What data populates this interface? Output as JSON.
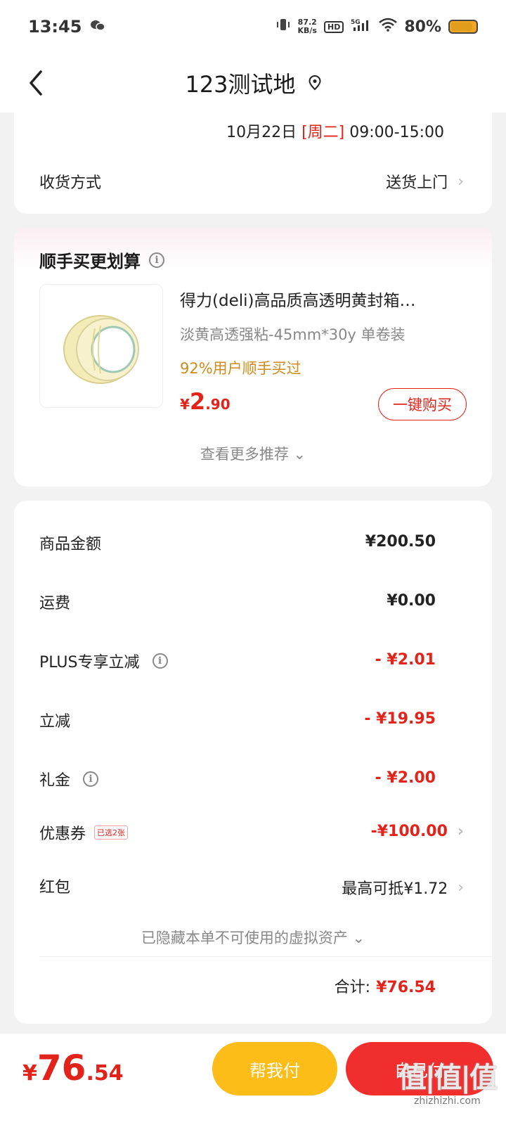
{
  "status_bar": {
    "time": "13:45",
    "net_speed_value": "87.2",
    "net_speed_unit": "KB/s",
    "hd": "HD",
    "network": "5G",
    "battery": "80%"
  },
  "header": {
    "title": "123测试地"
  },
  "delivery": {
    "date": "10月22日",
    "weekday": "[周二]",
    "time_range": "09:00-15:00",
    "method_label": "收货方式",
    "method_value": "送货上门"
  },
  "recommend": {
    "title": "顺手买更划算",
    "product": {
      "name": "得力(deli)高品质高透明黄封箱…",
      "spec": "淡黄高透强粘-45mm*30y 单卷装",
      "hint": "92%用户顺手买过",
      "price_symbol": "¥",
      "price_int": "2",
      "price_dec": ".90",
      "buy_label": "一键购买"
    },
    "more_label": "查看更多推荐 ⌄"
  },
  "fees": {
    "goods_label": "商品金额",
    "goods_value": "¥200.50",
    "shipping_label": "运费",
    "shipping_value": "¥0.00",
    "plus_label": "PLUS专享立减",
    "plus_value": "- ¥2.01",
    "discount_label": "立减",
    "discount_value": "- ¥19.95",
    "gift_label": "礼金",
    "gift_value": "- ¥2.00",
    "coupon_label": "优惠券",
    "coupon_tag": "已选2张",
    "coupon_value": "-¥100.00",
    "redpacket_label": "红包",
    "redpacket_value": "最高可抵¥1.72",
    "hidden_assets": "已隐藏本单不可使用的虚拟资产 ⌄",
    "total_label": "合计:",
    "total_value": "¥76.54"
  },
  "bottom": {
    "price_symbol": "¥",
    "price_int": "76",
    "price_dec": ".54",
    "help_pay": "帮我付",
    "self_pay": "自己付",
    "watermark": "值|值|值",
    "watermark_url": "zhizhizhi.com"
  },
  "colors": {
    "accent_red": "#e2231a",
    "help_pay_yellow": "#fdbd18",
    "self_pay_red": "#f12e2e",
    "hint_orange": "#d08a1a"
  }
}
